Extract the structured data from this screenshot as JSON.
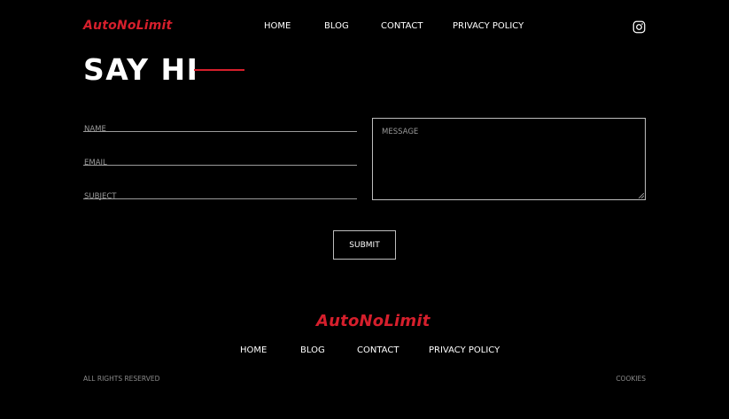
{
  "brand": {
    "name": "AutoNoLimit",
    "accent_color": "#d61f2c"
  },
  "header": {
    "nav": [
      "HOME",
      "BLOG",
      "CONTACT",
      "PRIVACY POLICY"
    ],
    "social_icon": "instagram-icon"
  },
  "contact": {
    "title": "SAY HI",
    "name_placeholder": "NAME",
    "email_placeholder": "EMAIL",
    "subject_placeholder": "SUBJECT",
    "message_placeholder": "MESSAGE",
    "submit_label": "SUBMIT"
  },
  "footer": {
    "nav": [
      "HOME",
      "BLOG",
      "CONTACT",
      "PRIVACY POLICY"
    ],
    "rights": "ALL RIGHTS RESERVED",
    "cookies": "COOKIES"
  }
}
